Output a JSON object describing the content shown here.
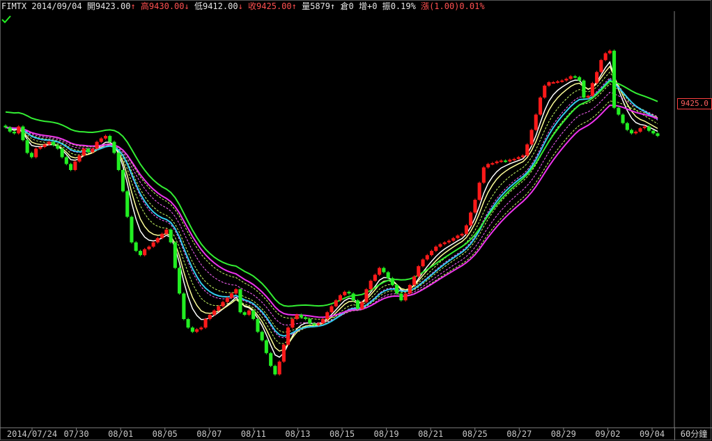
{
  "header": {
    "symbol": "FIMTX",
    "date": "2014/09/04",
    "open_label": "開",
    "open": "9423.00",
    "high_label": "高",
    "high": "9430.00",
    "low_label": "低",
    "low": "9412.00",
    "close_label": "收",
    "close": "9425.00",
    "volume_label": "量",
    "volume": "5879",
    "oi_label": "倉",
    "oi": "0",
    "oi_change_label": "增",
    "oi_change": "+0",
    "amplitude_label": "振",
    "amplitude": "0.19%",
    "change_label": "漲",
    "change": "(1.00)",
    "change_pct": "0.01%",
    "arrow_up": "↑",
    "arrow_down": "↓"
  },
  "price_tag": "9425.0",
  "period_label": "60分鐘",
  "colors": {
    "background": "#000000",
    "up_candle": "#ff1a1a",
    "down_candle": "#22ee22",
    "ma_white": "#ffffff",
    "ma_yellow": "#ffff99",
    "ma_cyan": "#33ccee",
    "ma_magenta": "#ee33ee",
    "ma_green": "#33ee33",
    "axis": "#808080"
  },
  "chart_data": {
    "type": "candlestick",
    "interval": "60 min",
    "x_tick_labels": [
      "2014/07/24",
      "07/30",
      "08/01",
      "08/05",
      "08/07",
      "08/11",
      "08/13",
      "08/15",
      "08/19",
      "08/21",
      "08/25",
      "08/27",
      "08/29",
      "09/02",
      "09/04"
    ],
    "last_price": 9425.0,
    "closes": [
      9435,
      9430,
      9428,
      9436,
      9420,
      9405,
      9400,
      9410,
      9412,
      9415,
      9418,
      9414,
      9410,
      9400,
      9392,
      9385,
      9395,
      9402,
      9410,
      9406,
      9410,
      9418,
      9422,
      9425,
      9418,
      9405,
      9385,
      9360,
      9330,
      9300,
      9290,
      9285,
      9292,
      9295,
      9300,
      9305,
      9310,
      9315,
      9300,
      9270,
      9240,
      9210,
      9200,
      9195,
      9198,
      9200,
      9210,
      9215,
      9220,
      9225,
      9230,
      9235,
      9240,
      9245,
      9218,
      9215,
      9220,
      9210,
      9195,
      9185,
      9170,
      9155,
      9145,
      9160,
      9180,
      9200,
      9210,
      9215,
      9212,
      9210,
      9205,
      9203,
      9205,
      9210,
      9218,
      9225,
      9232,
      9238,
      9242,
      9240,
      9232,
      9222,
      9230,
      9245,
      9255,
      9262,
      9270,
      9265,
      9258,
      9250,
      9240,
      9232,
      9240,
      9250,
      9260,
      9272,
      9280,
      9285,
      9290,
      9295,
      9298,
      9300,
      9302,
      9305,
      9308,
      9310,
      9320,
      9335,
      9350,
      9370,
      9388,
      9392,
      9393,
      9395,
      9396,
      9395,
      9397,
      9398,
      9400,
      9402,
      9415,
      9432,
      9450,
      9470,
      9484,
      9488,
      9488,
      9489,
      9490,
      9492,
      9495,
      9494,
      9490,
      9470,
      9472,
      9487,
      9500,
      9514,
      9522,
      9525,
      9458,
      9450,
      9440,
      9432,
      9428,
      9430,
      9434,
      9436,
      9431,
      9428,
      9425
    ]
  }
}
